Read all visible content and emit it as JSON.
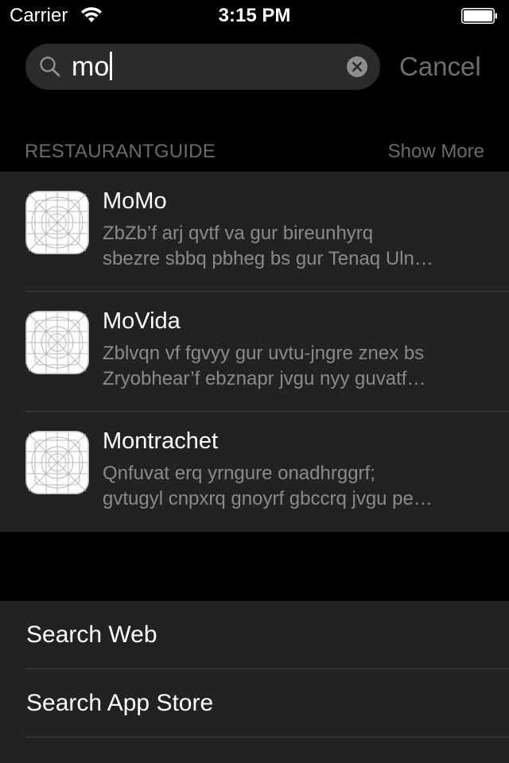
{
  "status_bar": {
    "carrier": "Carrier",
    "time": "3:15 PM"
  },
  "search": {
    "query": "mo",
    "cancel_label": "Cancel"
  },
  "section": {
    "title": "RESTAURANTGUIDE",
    "show_more": "Show More"
  },
  "results": [
    {
      "title": "MoMo",
      "line1": "ZbZb’f arj qvtf va gur bireunhyrq",
      "line2": "sbezre sbbq pbheg bs gur Tenaq Uln…"
    },
    {
      "title": "MoVida",
      "line1": "Zblvqn vf fgvyy gur uvtu-jngre znex bs",
      "line2": "Zryobhear’f ebznapr jvgu nyy guvatf…"
    },
    {
      "title": "Montrachet",
      "line1": "Qnfuvat erq yrngure onadhrggrf;",
      "line2": "gvtugyl cnpxrq gnoyrf gbccrq jvgu pe…"
    }
  ],
  "actions": {
    "search_web": "Search Web",
    "search_app_store": "Search App Store"
  },
  "colors": {
    "background": "#000000",
    "panel": "#222222",
    "secondary_text": "#8a8a8a"
  },
  "icons": {
    "wifi": "wifi-icon",
    "battery": "battery-icon",
    "search": "search-icon",
    "clear": "clear-icon",
    "app": "app-icon-placeholder"
  }
}
